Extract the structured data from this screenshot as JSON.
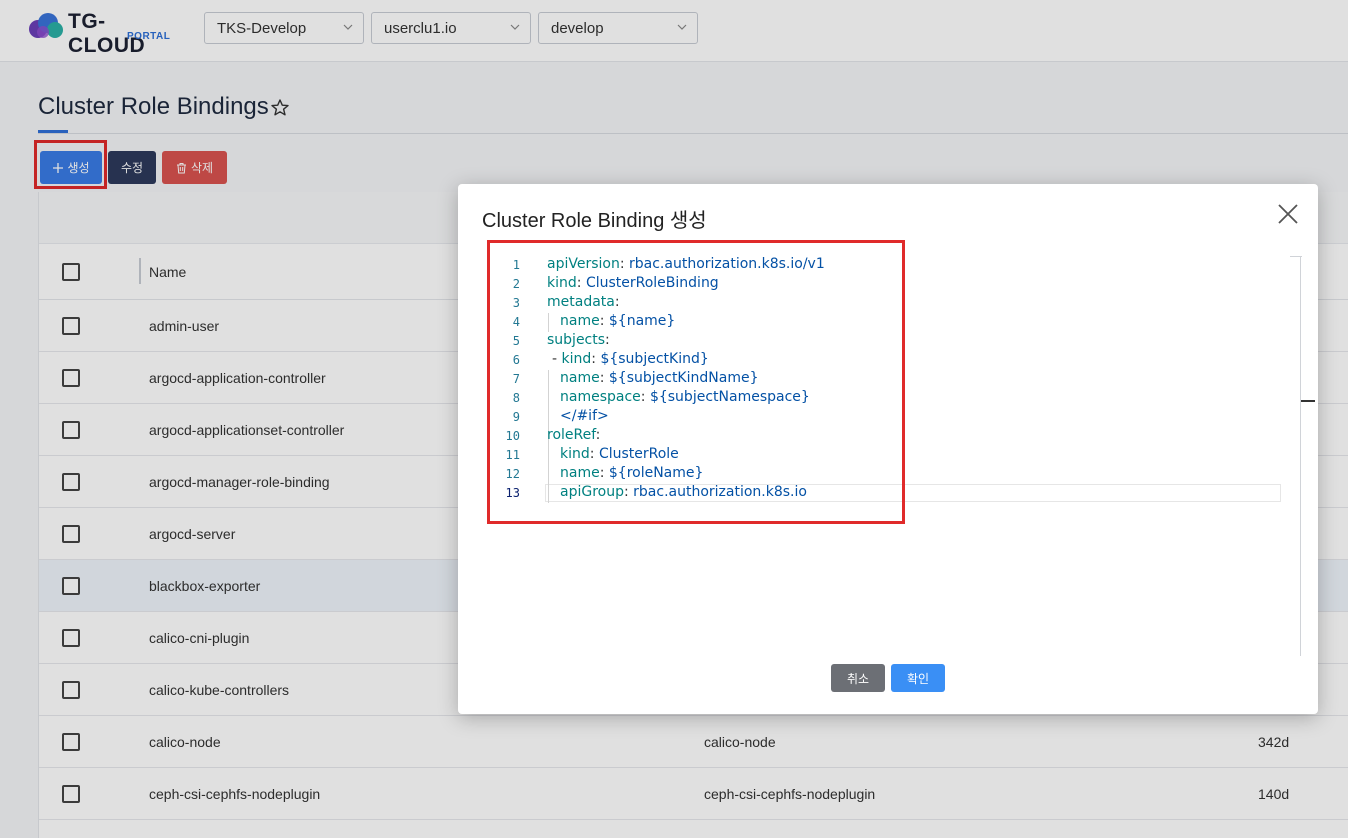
{
  "header": {
    "logo_text": "TG-CLOUD",
    "logo_sub": "PORTAL",
    "selects": [
      {
        "value": "TKS-Develop"
      },
      {
        "value": "userclu1.io"
      },
      {
        "value": "develop"
      }
    ]
  },
  "page": {
    "title": "Cluster Role Bindings",
    "toolbar": {
      "create_label": "생성",
      "edit_label": "수정",
      "delete_label": "삭제"
    }
  },
  "table": {
    "columns": [
      "Name"
    ],
    "rows": [
      {
        "name": "admin-user",
        "role": "",
        "age": ""
      },
      {
        "name": "argocd-application-controller",
        "role": "",
        "age": ""
      },
      {
        "name": "argocd-applicationset-controller",
        "role": "",
        "age": ""
      },
      {
        "name": "argocd-manager-role-binding",
        "role": "",
        "age": ""
      },
      {
        "name": "argocd-server",
        "role": "",
        "age": ""
      },
      {
        "name": "blackbox-exporter",
        "role": "",
        "age": ""
      },
      {
        "name": "calico-cni-plugin",
        "role": "",
        "age": ""
      },
      {
        "name": "calico-kube-controllers",
        "role": "",
        "age": ""
      },
      {
        "name": "calico-node",
        "role": "calico-node",
        "age": "342d"
      },
      {
        "name": "ceph-csi-cephfs-nodeplugin",
        "role": "ceph-csi-cephfs-nodeplugin",
        "age": "140d"
      }
    ]
  },
  "modal": {
    "title": "Cluster Role Binding 생성",
    "cancel_label": "취소",
    "ok_label": "확인",
    "code_lines": [
      {
        "n": "1",
        "key": "apiVersion",
        "sep": ": ",
        "val": "rbac.authorization.k8s.io/v1"
      },
      {
        "n": "2",
        "key": "kind",
        "sep": ": ",
        "val": "ClusterRoleBinding"
      },
      {
        "n": "3",
        "key": "metadata",
        "sep": ":",
        "val": ""
      },
      {
        "n": "4",
        "key": "name",
        "sep": ": ",
        "val": "${name}"
      },
      {
        "n": "5",
        "key": "subjects",
        "sep": ":",
        "val": ""
      },
      {
        "n": "6",
        "key": "kind",
        "sep": ": ",
        "val": "${subjectKind}"
      },
      {
        "n": "7",
        "key": "name",
        "sep": ": ",
        "val": "${subjectKindName}"
      },
      {
        "n": "8",
        "key": "namespace",
        "sep": ": ",
        "val": "${subjectNamespace}"
      },
      {
        "n": "9",
        "key": "",
        "sep": "",
        "val": "</#if>"
      },
      {
        "n": "10",
        "key": "roleRef",
        "sep": ":",
        "val": ""
      },
      {
        "n": "11",
        "key": "kind",
        "sep": ": ",
        "val": "ClusterRole"
      },
      {
        "n": "12",
        "key": "name",
        "sep": ": ",
        "val": "${roleName}"
      },
      {
        "n": "13",
        "key": "apiGroup",
        "sep": ": ",
        "val": "rbac.authorization.k8s.io"
      }
    ],
    "list_dash": "- "
  },
  "colors": {
    "primary": "#3a7be5",
    "highlight": "#e02a2a",
    "yaml_key": "#008080",
    "yaml_value": "#0451a5"
  }
}
